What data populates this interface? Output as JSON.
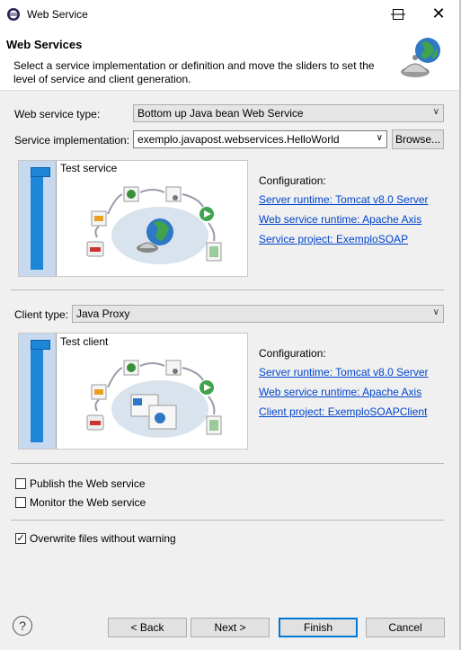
{
  "window": {
    "title": "Web Service"
  },
  "header": {
    "title": "Web Services",
    "description": "Select a service implementation or definition and move the sliders to set the level of service and client generation."
  },
  "service": {
    "type_label": "Web service type:",
    "type_value": "Bottom up Java bean Web Service",
    "impl_label": "Service implementation:",
    "impl_value": "exemplo.javapost.webservices.HelloWorld",
    "browse_label": "Browse...",
    "slider_label": "Test service",
    "config_title": "Configuration:",
    "server_runtime": "Server runtime: Tomcat v8.0 Server",
    "ws_runtime": "Web service runtime: Apache Axis",
    "project": "Service project: ExemploSOAP"
  },
  "client": {
    "type_label": "Client type:",
    "type_value": "Java Proxy",
    "slider_label": "Test client",
    "config_title": "Configuration:",
    "server_runtime": "Server runtime: Tomcat v8.0 Server",
    "ws_runtime": "Web service runtime: Apache Axis",
    "project": "Client project: ExemploSOAPClient"
  },
  "options": {
    "publish": {
      "label": "Publish the Web service",
      "checked": false
    },
    "monitor": {
      "label": "Monitor the Web service",
      "checked": false
    },
    "overwrite": {
      "label": "Overwrite files without warning",
      "checked": true
    }
  },
  "buttons": {
    "back": "< Back",
    "next": "Next >",
    "finish": "Finish",
    "cancel": "Cancel"
  },
  "colors": {
    "link": "#0044cc",
    "slider": "#1e86d8",
    "accent": "#0078d7"
  }
}
